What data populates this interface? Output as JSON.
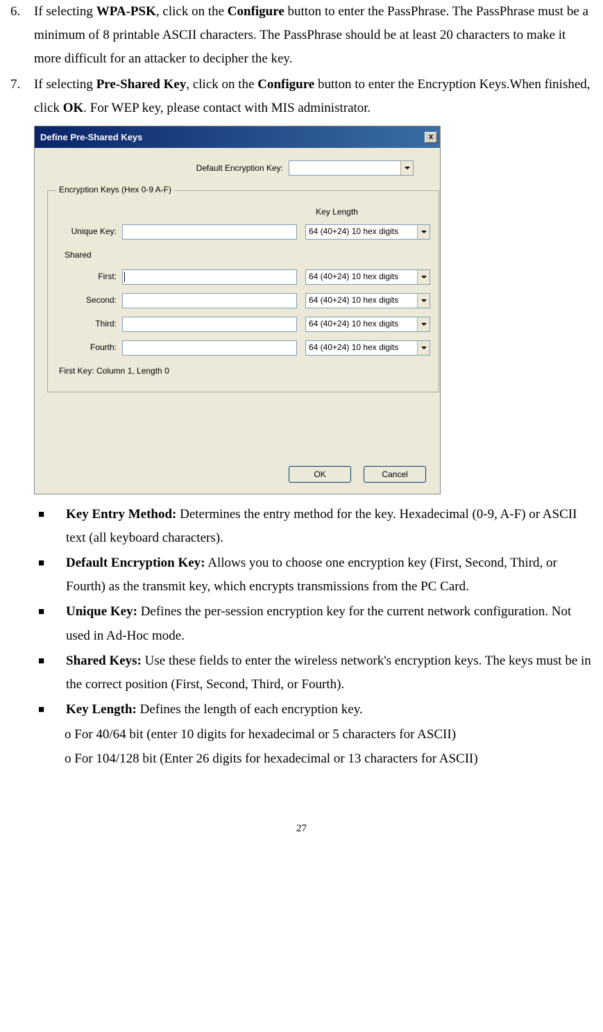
{
  "list": {
    "item6": {
      "num": "6.",
      "t1": "If selecting ",
      "b1": "WPA-PSK",
      "t2": ", click on the ",
      "b2": "Configure",
      "t3": " button to enter the PassPhrase. The PassPhrase must be a minimum of 8 printable ASCII characters. The PassPhrase   should be at least 20 characters to make it more difficult for an attacker to decipher the key."
    },
    "item7": {
      "num": "7.",
      "t1": "If selecting ",
      "b1": "Pre-Shared Key",
      "t2": ", click on the ",
      "b2": "Configure",
      "t3": " button to enter the Encryption Keys.When finished, click ",
      "b3": "OK",
      "t4": ". For WEP key, please contact with MIS administrator."
    }
  },
  "dialog": {
    "title": "Define Pre-Shared Keys",
    "close": "x",
    "default_label": "Default Encryption Key:",
    "default_value": "",
    "fieldset_legend": "Encryption Keys (Hex 0-9 A-F)",
    "keylen_header": "Key Length",
    "rows": {
      "unique": {
        "label": "Unique Key:",
        "value": "",
        "len": "64  (40+24)  10 hex digits"
      },
      "shared_header": "Shared",
      "first": {
        "label": "First:",
        "value": "",
        "len": "64  (40+24)  10 hex digits"
      },
      "second": {
        "label": "Second:",
        "value": "",
        "len": "64  (40+24)  10 hex digits"
      },
      "third": {
        "label": "Third:",
        "value": "",
        "len": "64  (40+24)  10 hex digits"
      },
      "fourth": {
        "label": "Fourth:",
        "value": "",
        "len": "64  (40+24)  10 hex digits"
      }
    },
    "status": "First Key: Column 1,  Length 0",
    "ok": "OK",
    "cancel": "Cancel"
  },
  "bullets": {
    "b1": {
      "title": "Key Entry Method:",
      "text": " Determines the entry method for the key. Hexadecimal (0-9, A-F) or ASCII text (all keyboard characters)."
    },
    "b2": {
      "title": "Default Encryption Key:",
      "text": " Allows you to choose one encryption key (First, Second, Third, or Fourth) as the transmit key, which encrypts transmissions from the PC Card."
    },
    "b3": {
      "title": "Unique Key:",
      "text": " Defines the per-session encryption key for the current network configuration. Not used in Ad-Hoc mode."
    },
    "b4": {
      "title": "Shared Keys:",
      "text": " Use these fields to enter the wireless network's encryption keys. The keys must be in the correct position (First, Second, Third, or Fourth)."
    },
    "b5": {
      "title": "Key Length:",
      "text": " Defines the length of each encryption key.",
      "sub1": "o For 40/64 bit (enter 10 digits for hexadecimal or 5 characters for ASCII)",
      "sub2": "o For 104/128 bit (Enter 26 digits for hexadecimal or 13 characters for ASCII)"
    }
  },
  "page_number": "27"
}
